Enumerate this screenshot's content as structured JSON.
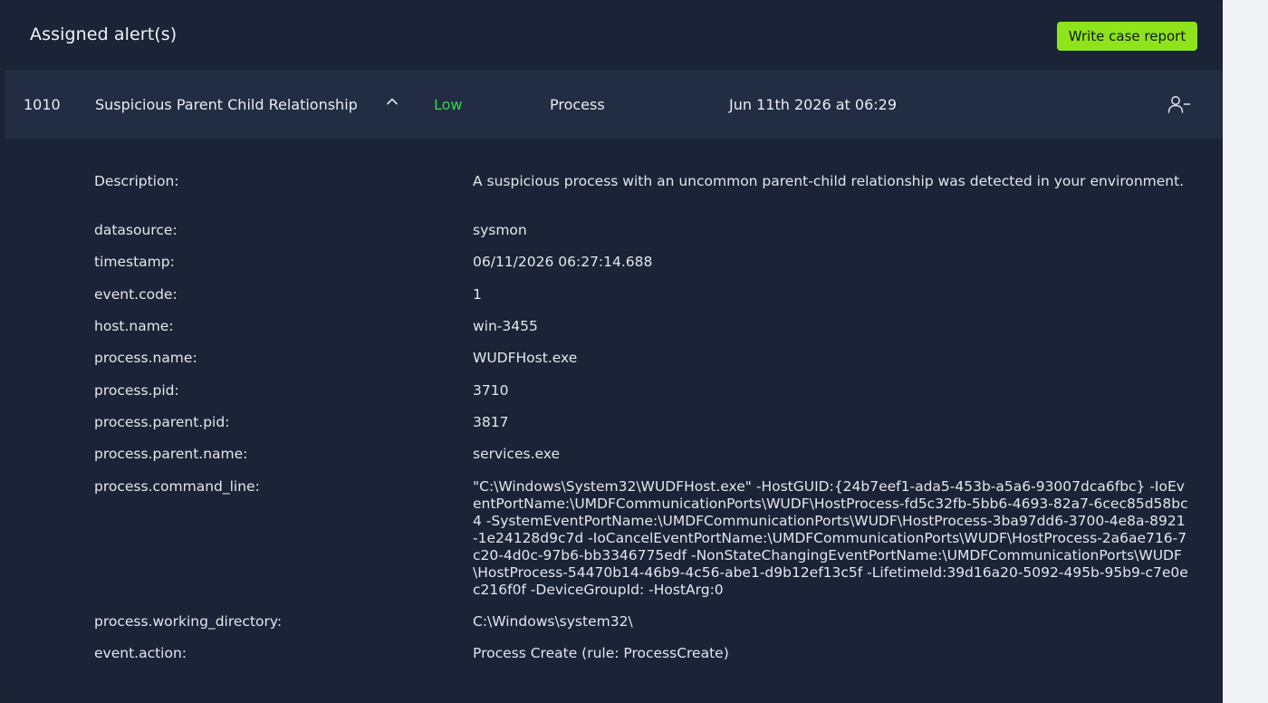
{
  "header": {
    "title": "Assigned alert(s)",
    "write_report_label": "Write case report"
  },
  "alert": {
    "id": "1010",
    "name": "Suspicious Parent Child Relationship",
    "severity": "Low",
    "category": "Process",
    "date": "Jun 11th 2026 at 06:29"
  },
  "details": [
    {
      "key": "Description:",
      "value": "A suspicious process with an uncommon parent-child relationship was detected in your environment."
    },
    {
      "key": "datasource:",
      "value": "sysmon"
    },
    {
      "key": "timestamp:",
      "value": "06/11/2026 06:27:14.688"
    },
    {
      "key": "event.code:",
      "value": "1"
    },
    {
      "key": "host.name:",
      "value": "win-3455"
    },
    {
      "key": "process.name:",
      "value": "WUDFHost.exe"
    },
    {
      "key": "process.pid:",
      "value": "3710"
    },
    {
      "key": "process.parent.pid:",
      "value": "3817"
    },
    {
      "key": "process.parent.name:",
      "value": "services.exe"
    },
    {
      "key": "process.command_line:",
      "value": "\"C:\\Windows\\System32\\WUDFHost.exe\" -HostGUID:{24b7eef1-ada5-453b-a5a6-93007dca6fbc} -IoEventPortName:\\UMDFCommunicationPorts\\WUDF\\HostProcess-fd5c32fb-5bb6-4693-82a7-6cec85d58bc4 -SystemEventPortName:\\UMDFCommunicationPorts\\WUDF\\HostProcess-3ba97dd6-3700-4e8a-8921-1e24128d9c7d -IoCancelEventPortName:\\UMDFCommunicationPorts\\WUDF\\HostProcess-2a6ae716-7c20-4d0c-97b6-bb3346775edf -NonStateChangingEventPortName:\\UMDFCommunicationPorts\\WUDF\\HostProcess-54470b14-46b9-4c56-abe1-d9b12ef13c5f -LifetimeId:39d16a20-5092-495b-95b9-c7e0ec216f0f -DeviceGroupId: -HostArg:0"
    },
    {
      "key": "process.working_directory:",
      "value": "C:\\Windows\\system32\\"
    },
    {
      "key": "event.action:",
      "value": "Process Create (rule: ProcessCreate)"
    }
  ],
  "colors": {
    "accent_button": "#8fe31a",
    "severity_low": "#3ad14a",
    "panel_bg": "#1b2437",
    "row_bg": "#222d43"
  }
}
